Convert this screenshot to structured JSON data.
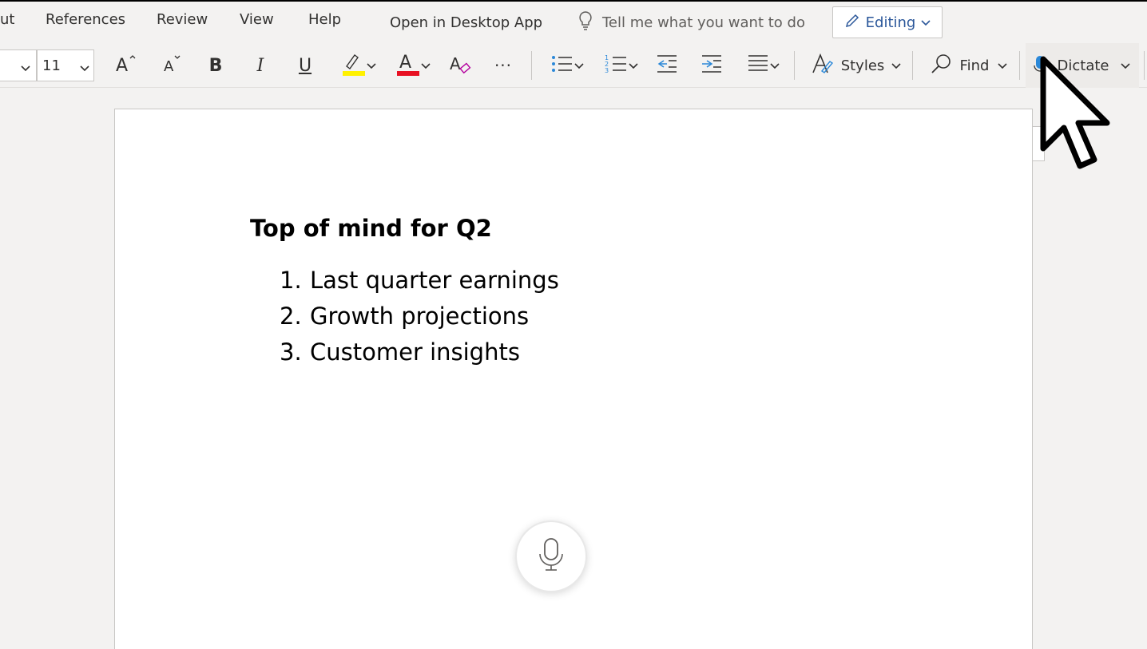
{
  "menu": {
    "items": [
      "ut",
      "References",
      "Review",
      "View",
      "Help"
    ],
    "open_desktop": "Open in Desktop App",
    "tell_me": "Tell me what you want to do",
    "editing": "Editing"
  },
  "ribbon": {
    "font_size": "11",
    "bold": "B",
    "italic": "I",
    "underline": "U",
    "more": "···",
    "styles": "Styles",
    "find": "Find",
    "dictate": "Dictate"
  },
  "colors": {
    "highlight": "#fff100",
    "font_color": "#e81123",
    "accent": "#2b579a",
    "list_icon": "#2b88d8"
  },
  "document": {
    "heading": "Top of mind for Q2",
    "items": [
      {
        "num": "1.",
        "text": "Last quarter earnings"
      },
      {
        "num": "2.",
        "text": "Growth projections"
      },
      {
        "num": "3.",
        "text": "Customer insights"
      }
    ]
  },
  "icons": [
    "lightbulb-icon",
    "pencil-icon",
    "chevron-down-icon",
    "grow-font-icon",
    "shrink-font-icon",
    "highlighter-icon",
    "font-color-icon",
    "clear-formatting-icon",
    "bullets-icon",
    "numbering-icon",
    "decrease-indent-icon",
    "increase-indent-icon",
    "align-icon",
    "styles-icon",
    "search-icon",
    "microphone-icon",
    "mouse-cursor-icon"
  ]
}
